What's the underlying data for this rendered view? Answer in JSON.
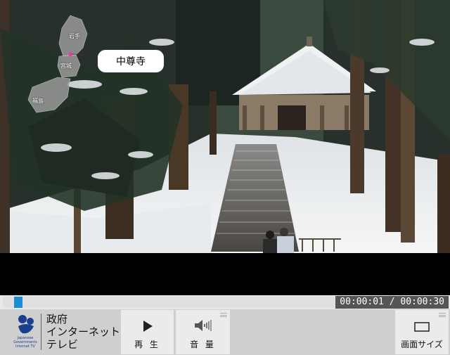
{
  "overlay": {
    "callout": "中尊寺",
    "prefectures": {
      "iwate": "岩手",
      "miyagi": "宮城",
      "fukushima": "福島"
    }
  },
  "player": {
    "time_current": "00:00:01",
    "time_separator": " / ",
    "time_total": "00:00:30",
    "progress": 0.033
  },
  "logo": {
    "subtitle_line1": "Japanese",
    "subtitle_line2": "Governments",
    "subtitle_line3": "Internet TV",
    "line1": "政府",
    "line2": "インターネット",
    "line3": "テレビ"
  },
  "buttons": {
    "play": "再 生",
    "volume": "音 量",
    "screen_size": "画面サイズ"
  },
  "colors": {
    "accent": "#1a8ecf",
    "logo_blue": "#1a3f8f"
  }
}
